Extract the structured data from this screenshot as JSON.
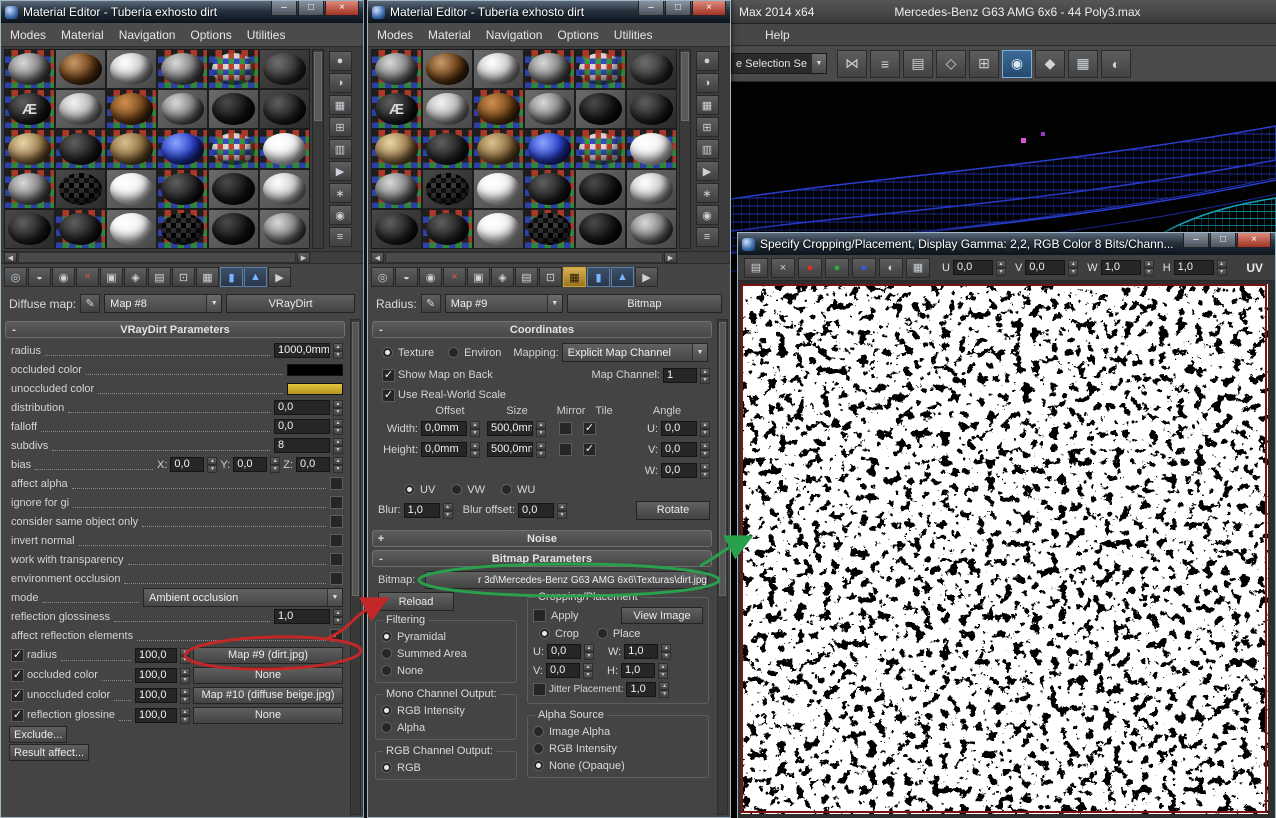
{
  "shared": {
    "menus": [
      "Modes",
      "Material",
      "Navigation",
      "Options",
      "Utilities"
    ],
    "window_buttons": [
      {
        "name": "minimize-button",
        "glyph": "–"
      },
      {
        "name": "maximize-button",
        "glyph": "□"
      },
      {
        "name": "close-button",
        "glyph": "×",
        "cls": "close"
      }
    ],
    "sample_slots": [
      "chk b-gray",
      "plain b-brown",
      "plain b-silver",
      "chk b-gray",
      "chk b-chk",
      "dark b-dgray",
      "chk b-logo",
      "plain b-lgray",
      "chk b-rust",
      "plain b-gray",
      "plain b-black",
      "dark b-dtex",
      "chk b-tan",
      "chk b-dark",
      "chk b-tan2",
      "chk b-blue",
      "chk b-chk",
      "chk b-white",
      "chk b-gray",
      "dark b-chkd",
      "plain b-white",
      "chk b-dark",
      "plain b-black",
      "plain b-silver",
      "dark b-dark",
      "chk b-dark",
      "plain b-white",
      "chk b-chkd",
      "plain b-black",
      "plain b-gray"
    ],
    "bottom_toolbar": [
      {
        "name": "get-material-icon",
        "glyph": "◎"
      },
      {
        "name": "put-material-to-scene-icon",
        "glyph": "◒"
      },
      {
        "name": "assign-material-to-selection-icon",
        "glyph": "◉"
      },
      {
        "name": "reset-map-icon",
        "glyph": "×",
        "cls": "red"
      },
      {
        "name": "make-material-copy-icon",
        "glyph": "▣"
      },
      {
        "name": "make-unique-icon",
        "glyph": "◈"
      },
      {
        "name": "put-to-library-icon",
        "glyph": "▤"
      },
      {
        "name": "material-id-channel-icon",
        "glyph": "⊡"
      },
      {
        "name": "show-map-in-viewport-icon",
        "glyph": "▦"
      },
      {
        "name": "show-end-result-icon",
        "glyph": "▮",
        "cls": "blue"
      },
      {
        "name": "go-to-parent-icon",
        "glyph": "▲",
        "cls": "blue"
      },
      {
        "name": "go-forward-to-sibling-icon",
        "glyph": "▶"
      }
    ],
    "side_toolbar": [
      {
        "name": "sample-type-icon",
        "glyph": "●"
      },
      {
        "name": "backlight-icon",
        "glyph": "◑"
      },
      {
        "name": "background-icon",
        "glyph": "▦"
      },
      {
        "name": "sample-uv-tiling-icon",
        "glyph": "⊞"
      },
      {
        "name": "video-color-check-icon",
        "glyph": "▥"
      },
      {
        "name": "make-preview-icon",
        "glyph": "▶"
      },
      {
        "name": "options-icon",
        "glyph": "∗"
      },
      {
        "name": "select-by-material-icon",
        "glyph": "◉"
      },
      {
        "name": "material-map-navigator-icon",
        "glyph": "≡"
      }
    ]
  },
  "e1": {
    "title": "Material Editor - Tubería exhosto dirt",
    "map_row": {
      "label": "Diffuse map:",
      "map": "Map #8",
      "type": "VRayDirt"
    },
    "rollout": "VRayDirt Parameters",
    "p": {
      "radius": {
        "label": "radius",
        "value": "1000,0mm"
      },
      "occluded": {
        "label": "occluded color"
      },
      "unoccluded": {
        "label": "unoccluded color"
      },
      "distribution": {
        "label": "distribution",
        "value": "0,0"
      },
      "falloff": {
        "label": "falloff",
        "value": "0,0"
      },
      "subdivs": {
        "label": "subdivs",
        "value": "8"
      },
      "bias": {
        "label": "bias",
        "x": "X:",
        "xv": "0,0",
        "y": "Y:",
        "yv": "0,0",
        "z": "Z:",
        "zv": "0,0"
      },
      "affect_alpha": {
        "label": "affect alpha"
      },
      "ignore_gi": {
        "label": "ignore for gi"
      },
      "same_object": {
        "label": "consider same object only"
      },
      "invert_normal": {
        "label": "invert normal"
      },
      "transparency": {
        "label": "work with transparency"
      },
      "env_occlusion": {
        "label": "environment occlusion"
      },
      "mode": {
        "label": "mode",
        "value": "Ambient occlusion"
      },
      "refl_gloss": {
        "label": "reflection glossiness",
        "value": "1,0"
      },
      "affect_refl": {
        "label": "affect reflection elements"
      }
    },
    "maps": [
      {
        "label": "radius",
        "amount": "100,0",
        "map": "Map #9 (dirt.jpg)"
      },
      {
        "label": "occluded color",
        "amount": "100,0",
        "map": "None"
      },
      {
        "label": "unoccluded color",
        "amount": "100,0",
        "map": "Map #10 (diffuse beige.jpg)"
      },
      {
        "label": "reflection glossine",
        "amount": "100,0",
        "map": "None"
      }
    ],
    "exclude": "Exclude...",
    "result_affect": "Result affect..."
  },
  "e2": {
    "title": "Material Editor - Tubería exhosto dirt",
    "map_row": {
      "label": "Radius:",
      "map": "Map #9",
      "type": "Bitmap"
    },
    "coords": {
      "rollout": "Coordinates",
      "texture": "Texture",
      "environ": "Environ",
      "mapping_label": "Mapping:",
      "mapping": "Explicit Map Channel",
      "show_back": "Show Map on Back",
      "map_channel_label": "Map Channel:",
      "map_channel": "1",
      "real_world": "Use Real-World Scale",
      "h_offset": "Offset",
      "h_size": "Size",
      "h_mirror": "Mirror",
      "h_tile": "Tile",
      "h_angle": "Angle",
      "width_label": "Width:",
      "width_offset": "0,0mm",
      "width_size": "500,0mm",
      "height_label": "Height:",
      "height_offset": "0,0mm",
      "height_size": "500,0mm",
      "u_label": "U:",
      "u_value": "0,0",
      "v_label": "V:",
      "v_value": "0,0",
      "w_label": "W:",
      "w_value": "0,0",
      "uvw": [
        {
          "name": "uv-radio",
          "label": "UV",
          "on": true
        },
        {
          "name": "vw-radio",
          "label": "VW"
        },
        {
          "name": "wu-radio",
          "label": "WU"
        }
      ],
      "blur_label": "Blur:",
      "blur": "1,0",
      "blur_offset_label": "Blur offset:",
      "blur_offset": "0,0",
      "rotate": "Rotate"
    },
    "noise_rollout": "Noise",
    "bp": {
      "rollout": "Bitmap Parameters",
      "bitmap_label": "Bitmap:",
      "path": "r 3d\\Mercedes-Benz G63 AMG 6x6\\Texturas\\dirt.jpg",
      "reload": "Reload",
      "cropping": {
        "title": "Cropping/Placement",
        "apply": "Apply",
        "view_image": "View Image",
        "modes": [
          {
            "name": "crop-radio",
            "label": "Crop",
            "on": true
          },
          {
            "name": "place-radio",
            "label": "Place"
          }
        ],
        "u_label": "U:",
        "u": "0,0",
        "w_label": "W:",
        "w": "1,0",
        "v_label": "V:",
        "v": "0,0",
        "h_label": "H:",
        "h": "1,0",
        "jitter_label": "Jitter Placement:",
        "jitter": "1,0"
      },
      "filtering": {
        "title": "Filtering",
        "options": [
          {
            "name": "pyramidal-radio",
            "label": "Pyramidal",
            "on": true
          },
          {
            "name": "summed-area-radio",
            "label": "Summed Area"
          },
          {
            "name": "filtering-none-radio",
            "label": "None"
          }
        ]
      },
      "mono": {
        "title": "Mono Channel Output:",
        "options": [
          {
            "name": "mono-rgb-intensity-radio",
            "label": "RGB Intensity",
            "on": true
          },
          {
            "name": "mono-alpha-radio",
            "label": "Alpha"
          }
        ]
      },
      "rgb": {
        "title": "RGB Channel Output:",
        "options": [
          {
            "name": "rgb-out-radio",
            "label": "RGB",
            "on": true
          }
        ]
      },
      "alpha_source": {
        "title": "Alpha Source",
        "options": [
          {
            "name": "image-alpha-radio",
            "label": "Image Alpha"
          },
          {
            "name": "alpha-rgb-intensity-radio",
            "label": "RGB Intensity"
          },
          {
            "name": "alpha-none-opaque-radio",
            "label": "None (Opaque)",
            "on": true
          }
        ]
      }
    }
  },
  "main": {
    "title_product": "Max  2014 x64",
    "title_doc": "Mercedes-Benz G63 AMG 6x6 - 44 Poly3.max",
    "menus": [
      "Help"
    ],
    "selection_dropdown": "e Selection Se",
    "toolbar": [
      {
        "name": "mirror-icon",
        "glyph": "⋈"
      },
      {
        "name": "align-icon",
        "glyph": "≡"
      },
      {
        "name": "layer-manager-icon",
        "glyph": "▤"
      },
      {
        "name": "graph-editors-icon",
        "glyph": "◇"
      },
      {
        "name": "schematic-view-icon",
        "glyph": "⊞"
      },
      {
        "name": "material-editor-icon",
        "glyph": "◉",
        "cls": "on"
      },
      {
        "name": "render-setup-icon",
        "glyph": "◆"
      },
      {
        "name": "rendered-frame-icon",
        "glyph": "▦"
      },
      {
        "name": "render-production-icon",
        "glyph": "◐"
      }
    ]
  },
  "dialog": {
    "title": "Specify Cropping/Placement, Display Gamma: 2,2, RGB Color 8 Bits/Chann...",
    "icons": [
      {
        "name": "print-icon",
        "glyph": "▤"
      },
      {
        "name": "delete-icon",
        "glyph": "×"
      },
      {
        "name": "red-channel-icon",
        "glyph": "●",
        "cls": "chR"
      },
      {
        "name": "green-channel-icon",
        "glyph": "●",
        "cls": "chG"
      },
      {
        "name": "blue-channel-icon",
        "glyph": "●",
        "cls": "chB"
      },
      {
        "name": "alpha-channel-icon",
        "glyph": "◐"
      },
      {
        "name": "color-swatch-icon",
        "glyph": "▦"
      }
    ],
    "fields": [
      {
        "name": "crop-u-field",
        "label": "U",
        "value": "0,0"
      },
      {
        "name": "crop-v-field",
        "label": "V",
        "value": "0,0"
      },
      {
        "name": "crop-w-field",
        "label": "W",
        "value": "1,0"
      },
      {
        "name": "crop-h-field",
        "label": "H",
        "value": "1,0"
      }
    ],
    "uv_label": "UV"
  },
  "colors": {
    "annotation_red": "#c42727",
    "annotation_green": "#28a04c",
    "occluded_swatch": "#000000",
    "unoccluded_swatch": "#e3c53d"
  }
}
